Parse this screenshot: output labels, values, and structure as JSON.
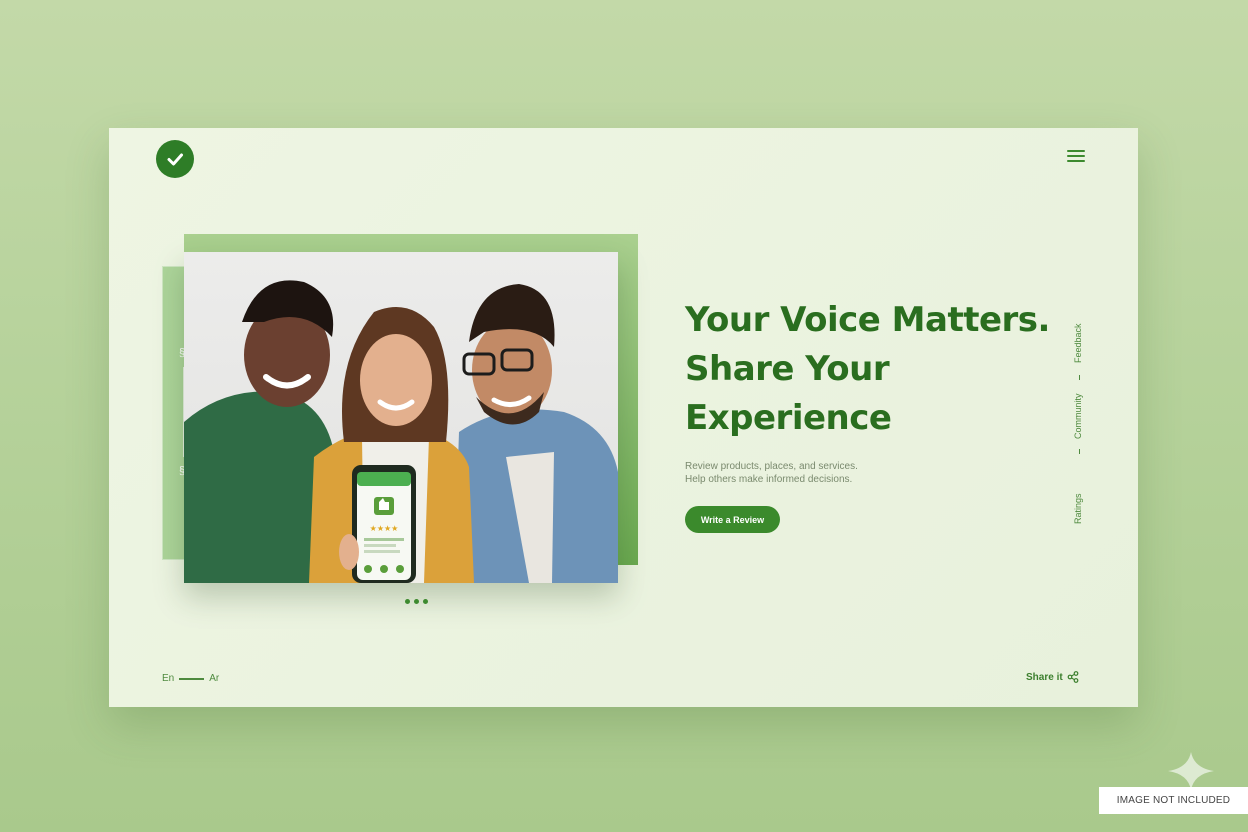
{
  "header": {
    "logo_icon": "check-circle-icon",
    "menu_icon": "hamburger-menu-icon"
  },
  "hero": {
    "headline_lines": [
      "Your Voice Matters.",
      "Share Your",
      "Experience"
    ],
    "subtext_lines": [
      "Review products, places, and services.",
      "Help others make informed decisions."
    ],
    "cta_label": "Write a Review",
    "phone_rating_stars": "★★★★",
    "carousel_slides": 3
  },
  "side_nav": {
    "items": [
      "Feedback",
      "Community",
      "Ratings"
    ]
  },
  "footer": {
    "lang_en": "En",
    "lang_ar": "Ar",
    "share_label": "Share it",
    "share_icon": "share-icon"
  },
  "watermark": {
    "label": "IMAGE NOT INCLUDED"
  },
  "colors": {
    "brand_green": "#2e7d27",
    "cta_green": "#3b8a2c",
    "page_bg": "#b6d29b",
    "card_bg": "#eef5e3"
  }
}
